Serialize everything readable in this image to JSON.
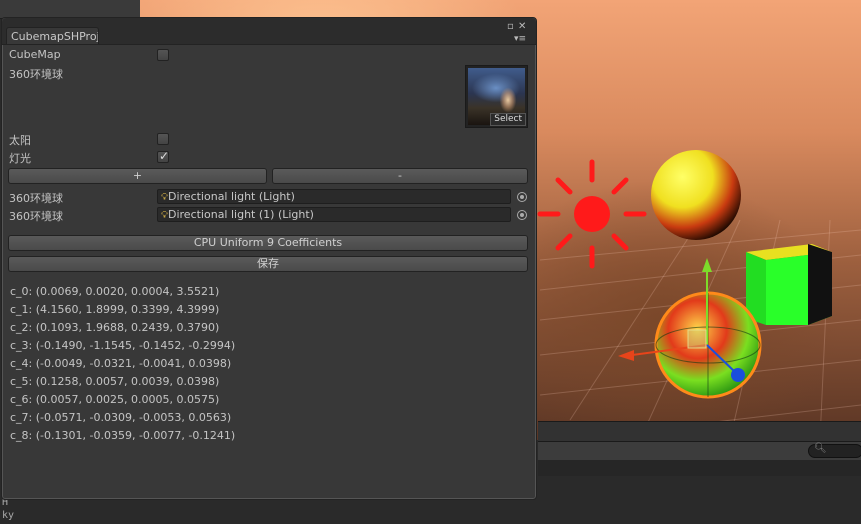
{
  "window": {
    "tab_title": "CubemapSHProject"
  },
  "fields": {
    "cubemap_label": "CubeMap",
    "env_label": "360环境球",
    "sun_label": "太阳",
    "light_label": "灯光",
    "cubemap_checked": false,
    "sun_checked": false,
    "light_checked": true,
    "select_label": "Select"
  },
  "buttons": {
    "add": "+",
    "remove": "-",
    "mode": "CPU Uniform 9 Coefficients",
    "save": "保存"
  },
  "lights": [
    {
      "label": "360环境球",
      "value": "Directional light (Light)"
    },
    {
      "label": "360环境球",
      "value": "Directional light (1) (Light)"
    }
  ],
  "coefficients": [
    "c_0: (0.0069, 0.0020, 0.0004, 3.5521)",
    "c_1: (4.1560, 1.8999, 0.3399, 4.3999)",
    "c_2: (0.1093, 1.9688, 0.2439, 0.3790)",
    "c_3: (-0.1490, -1.1545, -0.1452, -0.2994)",
    "c_4: (-0.0049, -0.0321, -0.0041, 0.0398)",
    "c_5: (0.1258, 0.0057, 0.0039, 0.0398)",
    "c_6: (0.0057, 0.0025, 0.0005, 0.0575)",
    "c_7: (-0.0571, -0.0309, -0.0053, 0.0563)",
    "c_8: (-0.1301, -0.0359, -0.0077, -0.1241)"
  ],
  "under_text": [
    "H",
    "ky"
  ],
  "icons": [
    "maximize-icon",
    "close-icon",
    "menu-icon",
    "bulb-icon",
    "object-picker-icon",
    "sun-gizmo-icon",
    "move-gizmo-icon"
  ],
  "colors": {
    "panel_bg": "#383838",
    "sun_gizmo": "#ff1a1a",
    "gizmo_y": "#7ddc2a",
    "gizmo_x": "#e8441a",
    "gizmo_z": "#1a4fdc"
  }
}
